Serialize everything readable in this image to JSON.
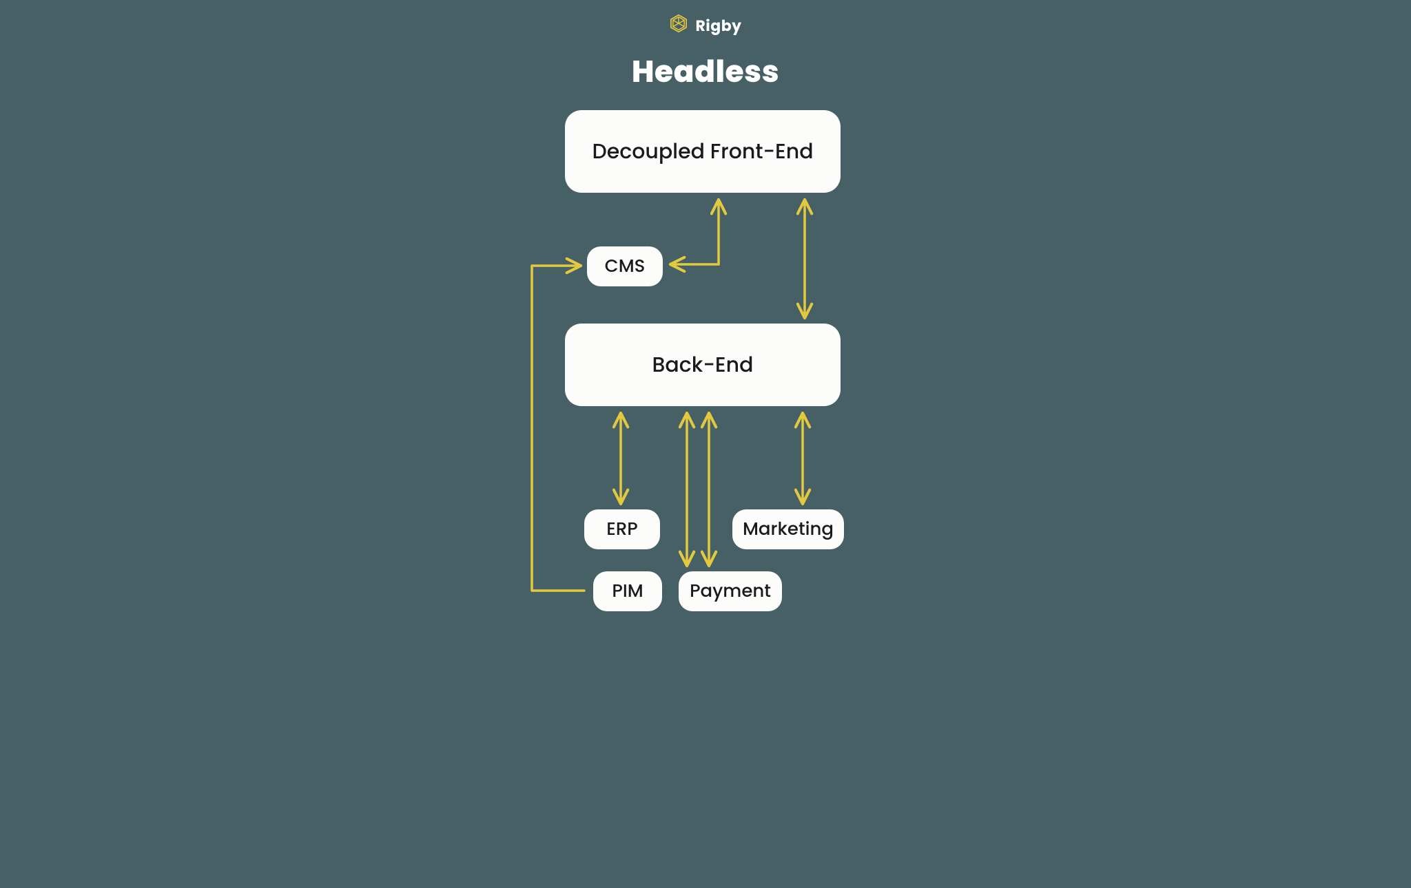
{
  "brand": {
    "name": "Rigby"
  },
  "title": "Headless",
  "nodes": {
    "frontend": "Decoupled Front-End",
    "cms": "CMS",
    "backend": "Back-End",
    "erp": "ERP",
    "marketing": "Marketing",
    "pim": "PIM",
    "payment": "Payment"
  },
  "colors": {
    "accent": "#e3c93f",
    "bg": "#476066",
    "node_bg": "#fcfcfa",
    "node_text": "#1a1a1a"
  },
  "diagram": {
    "edges": [
      {
        "from": "frontend",
        "to": "backend",
        "bidirectional": true
      },
      {
        "from": "frontend",
        "to": "cms",
        "bidirectional": true
      },
      {
        "from": "backend",
        "to": "erp",
        "bidirectional": true
      },
      {
        "from": "backend",
        "to": "marketing",
        "bidirectional": true
      },
      {
        "from": "backend",
        "to": "pim",
        "bidirectional": true
      },
      {
        "from": "backend",
        "to": "payment",
        "bidirectional": true
      },
      {
        "from": "pim",
        "to": "cms",
        "bidirectional": false
      }
    ]
  }
}
